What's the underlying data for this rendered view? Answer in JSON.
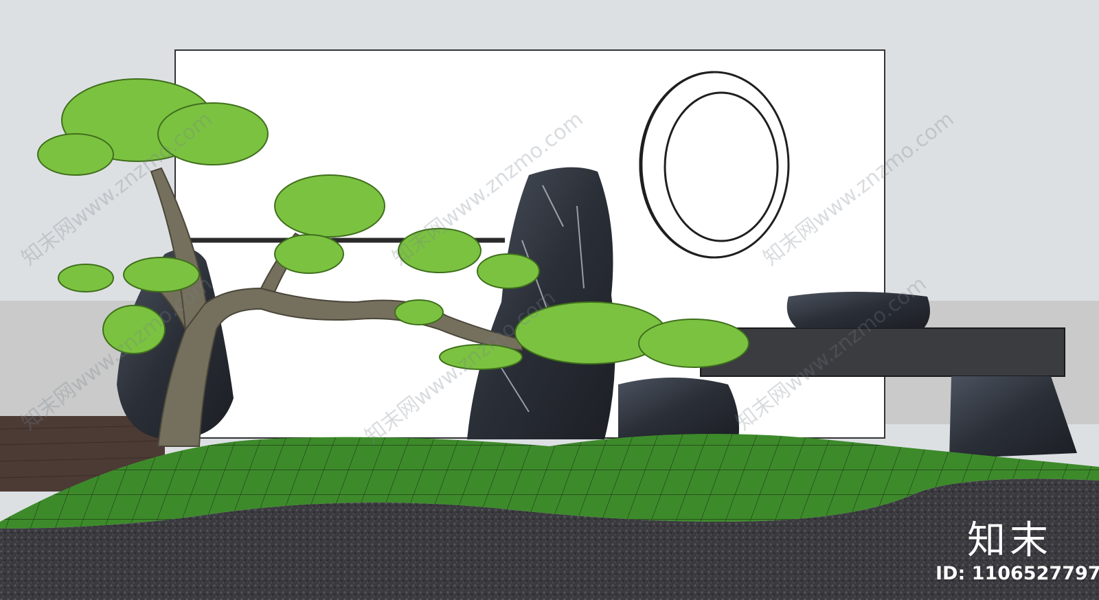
{
  "scene": {
    "description_icon": "landscape-render",
    "colors": {
      "sky": "#dde0e3",
      "wall": "#ffffff",
      "lower_wall": "#c9cac9",
      "deck": "#4a3a34",
      "moon": "#f8cd73",
      "lawn": "#3f8b2c",
      "gravel": "#3b3b40",
      "rock": "#2c3038",
      "foliage": "#7cc241",
      "trunk": "#6f6a58",
      "bench": "#3a3c40"
    }
  },
  "watermark": {
    "brand": "知末",
    "asset_id": "ID: 1106527797",
    "repeat_text": "知末网www.znzmo.com"
  }
}
